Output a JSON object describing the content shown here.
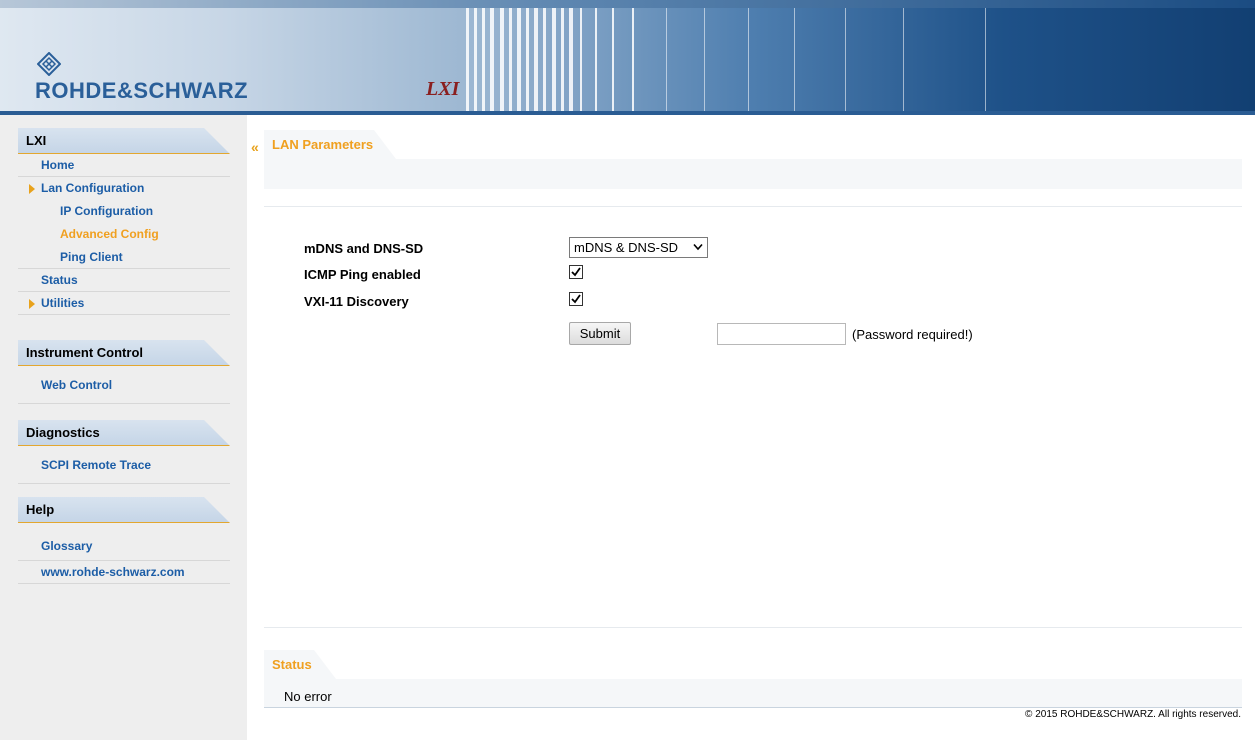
{
  "header": {
    "brand": "ROHDE&SCHWARZ",
    "lxi_logo": "LXI"
  },
  "sidebar": {
    "sections": [
      {
        "title": "LXI",
        "items": [
          {
            "label": "Home"
          },
          {
            "label": "Lan Configuration",
            "expanded": true
          },
          {
            "label": "IP Configuration"
          },
          {
            "label": "Advanced Config",
            "active": true
          },
          {
            "label": "Ping Client"
          },
          {
            "label": "Status"
          },
          {
            "label": "Utilities",
            "expandable": true
          }
        ]
      },
      {
        "title": "Instrument Control",
        "items": [
          {
            "label": "Web Control"
          }
        ]
      },
      {
        "title": "Diagnostics",
        "items": [
          {
            "label": "SCPI Remote Trace"
          }
        ]
      },
      {
        "title": "Help",
        "items": [
          {
            "label": "Glossary"
          },
          {
            "label": "www.rohde-schwarz.com"
          }
        ]
      }
    ]
  },
  "main": {
    "tab_title": "LAN Parameters",
    "form": {
      "mdns_label": "mDNS and DNS-SD",
      "mdns_value": "mDNS & DNS-SD",
      "icmp_label": "ICMP Ping enabled",
      "icmp_checked": true,
      "vxi_label": "VXI-11 Discovery",
      "vxi_checked": true,
      "submit_label": "Submit",
      "password_value": "",
      "password_note": "(Password required!)"
    }
  },
  "status": {
    "tab_title": "Status",
    "message": "No error"
  },
  "footer": {
    "copyright": "© 2015 ROHDE&SCHWARZ. All rights reserved."
  },
  "colors": {
    "accent_orange": "#f0a020",
    "link_blue": "#1c5da6",
    "header_dark": "#123f72",
    "sidebar_bg": "#eeeeee"
  }
}
